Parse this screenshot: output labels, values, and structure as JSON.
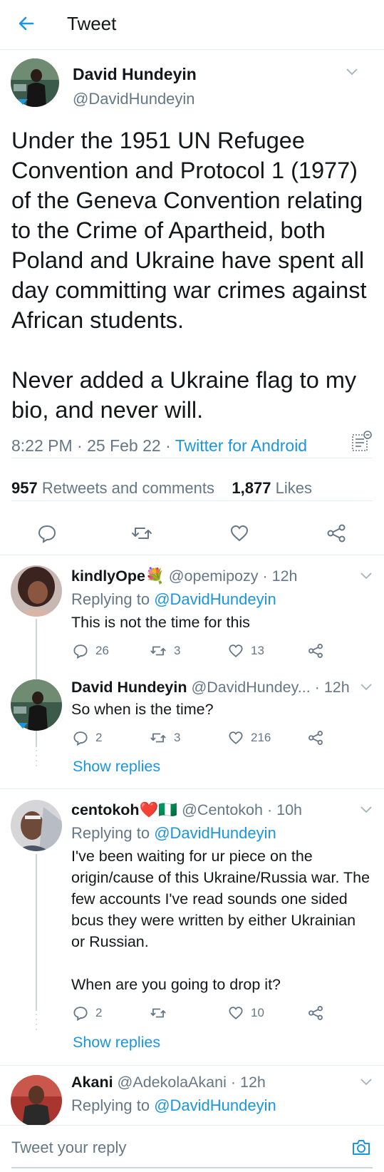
{
  "header": {
    "title": "Tweet"
  },
  "main_tweet": {
    "author_name": "David Hundeyin",
    "author_handle": "@DavidHundeyin",
    "text": "Under the 1951 UN Refugee Convention and Protocol 1 (1977) of the Geneva Convention relating to the Crime of Apartheid, both Poland and Ukraine have spent all day committing war crimes against African students.\n\nNever added a Ukraine flag to my bio, and never will.",
    "time": "8:22 PM",
    "date": "25 Feb 22",
    "source": "Twitter for Android",
    "retweets_count": "957",
    "retweets_label": "Retweets and comments",
    "likes_count": "1,877",
    "likes_label": "Likes"
  },
  "replies": [
    {
      "name": "kindlyOpe💐",
      "handle": "@opemipozy",
      "time": "12h",
      "replying_prefix": "Replying to",
      "replying_to": "@DavidHundeyin",
      "text": "This is not the time for this",
      "comments": "26",
      "retweets": "3",
      "likes": "13"
    },
    {
      "name": "David Hundeyin",
      "handle": "@DavidHundey...",
      "time": "12h",
      "text": "So when is the time?",
      "comments": "2",
      "retweets": "3",
      "likes": "216",
      "show_replies": "Show replies"
    },
    {
      "name": "centokoh",
      "name_emoji": "❤️🇳🇬",
      "handle": "@Centokoh",
      "time": "10h",
      "replying_prefix": "Replying to",
      "replying_to": "@DavidHundeyin",
      "text": "I've been waiting for ur piece on the origin/cause of this Ukraine/Russia war. The few accounts I've read sounds one sided bcus they were written by either Ukrainian or Russian.\n\nWhen are you going to drop it?",
      "comments": "2",
      "retweets": "",
      "likes": "10",
      "show_replies": "Show replies"
    },
    {
      "name": "Akani",
      "handle": "@AdekolaAkani",
      "time": "12h",
      "replying_prefix": "Replying to",
      "replying_to": "@DavidHundeyin"
    }
  ],
  "composer": {
    "placeholder": "Tweet your reply"
  },
  "colors": {
    "accent": "#1b95e0",
    "muted": "#657786",
    "divider": "#e6ecf0"
  },
  "icons": [
    "back-arrow-icon",
    "chevron-down-icon",
    "tweet-details-icon",
    "reply-icon",
    "retweet-icon",
    "like-icon",
    "share-icon",
    "camera-icon"
  ]
}
